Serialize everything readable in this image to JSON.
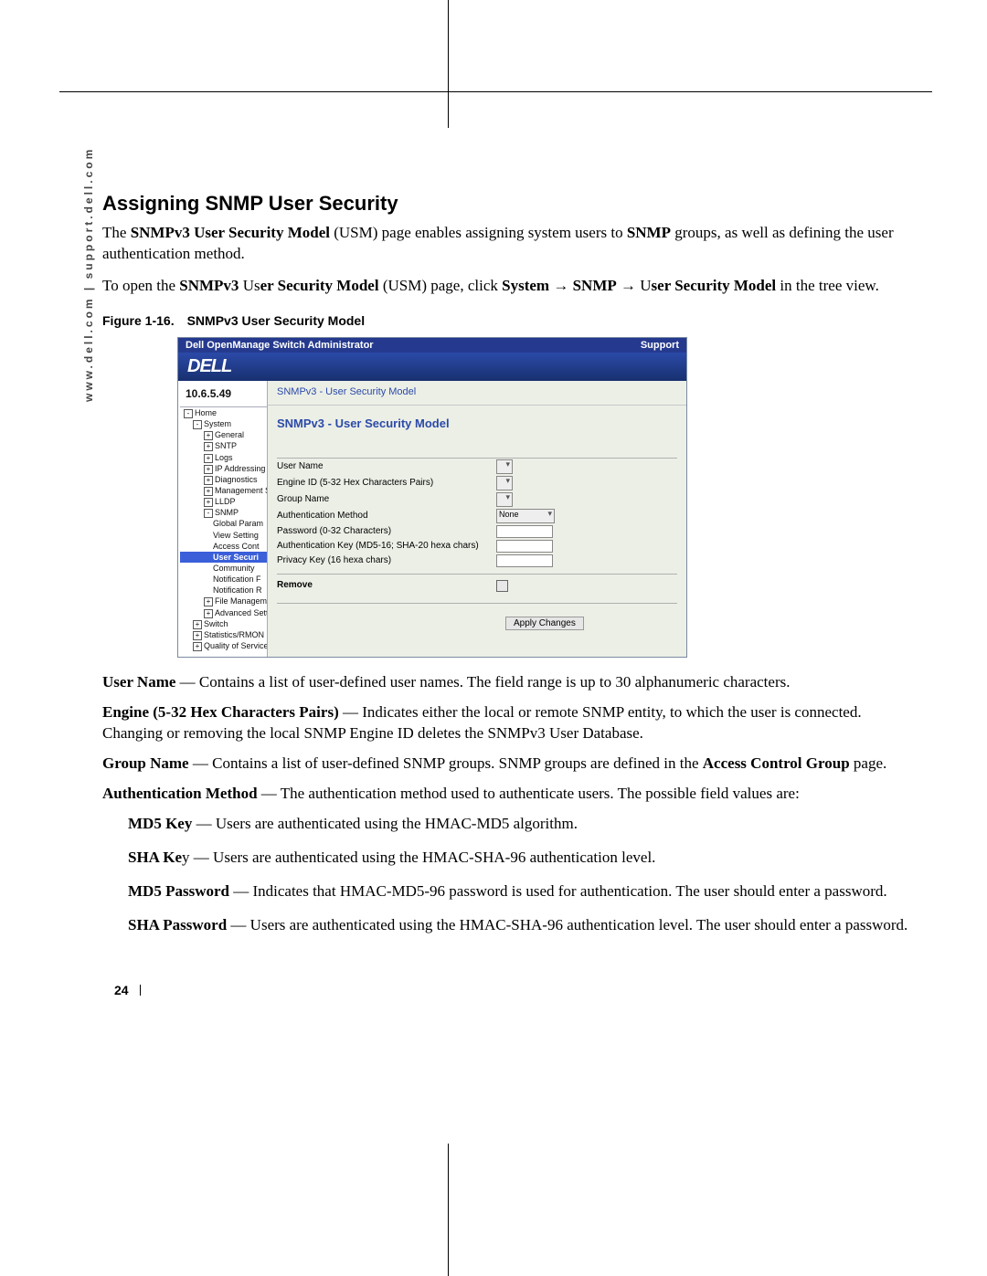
{
  "side_text": "www.dell.com | support.dell.com",
  "section_title": "Assigning SNMP User Security",
  "intro_p1": {
    "a": "The ",
    "b": "SNMPv3 User Security Model",
    "c": " (USM) page enables assigning system users to ",
    "d": "SNMP",
    "e": " groups, as well as defining the user authentication method."
  },
  "intro_p2": {
    "a": "To open the ",
    "b": "SNMPv3 ",
    "c": "Us",
    "d": "er Security Model",
    "e": " (USM) page, click ",
    "f": "System",
    "g": " → ",
    "h": "SNMP",
    "i": " → ",
    "j": "U",
    "k": "ser Security Model",
    "l": " in the tree view."
  },
  "figcap_a": "Figure 1-16.",
  "figcap_b": "SNMPv3 User Security Model",
  "ss": {
    "titlebar_left": "Dell OpenManage Switch Administrator",
    "titlebar_right": "Support",
    "brand": "DELL",
    "ip": "10.6.5.49",
    "crumb": "SNMPv3 - User Security Model",
    "head": "SNMPv3 - User Security Model",
    "tree": {
      "home": "Home",
      "system": "System",
      "general": "General",
      "sntp": "SNTP",
      "logs": "Logs",
      "ipaddr": "IP Addressing",
      "diag": "Diagnostics",
      "mgmt": "Management Se",
      "lldp": "LLDP",
      "snmp": "SNMP",
      "global": "Global Param",
      "views": "View Setting",
      "access": "Access Cont",
      "usersec": "User Securi",
      "community": "Community",
      "notifF": "Notification F",
      "notifR": "Notification R",
      "filemgr": "File Managemen",
      "adv": "Advanced Settin",
      "switch": "Switch",
      "stats": "Statistics/RMON",
      "qos": "Quality of Service"
    },
    "fields": {
      "user_name": "User Name",
      "engine": "Engine ID (5-32 Hex Characters Pairs)",
      "group": "Group Name",
      "auth": "Authentication Method",
      "auth_val": "None",
      "pwd": "Password (0-32 Characters)",
      "authkey": "Authentication Key (MD5-16; SHA-20 hexa chars)",
      "priv": "Privacy Key (16 hexa chars)",
      "remove": "Remove",
      "apply": "Apply Changes"
    }
  },
  "defs": {
    "user_a": "User Name",
    "user_b": " — Contains a list of user-defined user names. The field range is up to 30 alphanumeric characters.",
    "engine_a": "Engine (5-32 Hex Characters Pairs)",
    "engine_b": " — Indicates either the local or remote SNMP entity, to which the user is connected. Changing or removing the local SNMP Engine ID deletes the SNMPv3 User Database.",
    "group_a": "Group Name",
    "group_b": " — Contains a list of user-defined SNMP groups. SNMP groups are defined in the ",
    "group_c": "Access Control Group",
    "group_d": " page.",
    "auth_a": "Authentication Method",
    "auth_b": " — The authentication method used to authenticate users. The possible field values are:",
    "md5k_a": "MD5 Key",
    "md5k_b": " — Users are authenticated using the HMAC-MD5 algorithm.",
    "shak_a": "SHA Ke",
    "shak_b": "y — Users are authenticated using the HMAC-SHA-96 authentication level.",
    "md5p_a": "MD5 Password",
    "md5p_b": " — Indicates that HMAC-MD5-96 password is used for authentication. The user should enter a password.",
    "shap_a": "SHA Password",
    "shap_b": " — Users are authenticated using the HMAC-SHA-96 authentication level. The user should enter a password."
  },
  "page_num": "24"
}
